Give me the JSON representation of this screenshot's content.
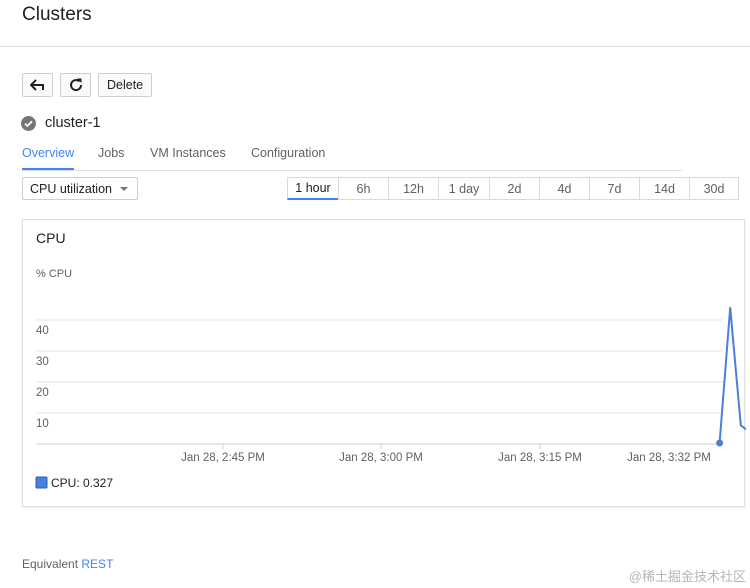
{
  "page": {
    "title": "Clusters"
  },
  "toolbar": {
    "back_icon": "back-arrow-icon",
    "refresh_icon": "refresh-icon",
    "delete_label": "Delete"
  },
  "cluster": {
    "status_icon": "check-circle-icon",
    "name": "cluster-1"
  },
  "tabs": [
    {
      "label": "Overview",
      "active": true
    },
    {
      "label": "Jobs",
      "active": false
    },
    {
      "label": "VM Instances",
      "active": false
    },
    {
      "label": "Configuration",
      "active": false
    }
  ],
  "metric_select": {
    "value": "CPU utilization"
  },
  "time_ranges": [
    {
      "label": "1 hour",
      "active": true
    },
    {
      "label": "6h",
      "active": false
    },
    {
      "label": "12h",
      "active": false
    },
    {
      "label": "1 day",
      "active": false
    },
    {
      "label": "2d",
      "active": false
    },
    {
      "label": "4d",
      "active": false
    },
    {
      "label": "7d",
      "active": false
    },
    {
      "label": "14d",
      "active": false
    },
    {
      "label": "30d",
      "active": false
    }
  ],
  "chart_data": {
    "type": "line",
    "title": "CPU",
    "ylabel": "% CPU",
    "xlabel": "",
    "ylim": [
      0,
      50
    ],
    "y_ticks": [
      10,
      20,
      30,
      40
    ],
    "x_ticks": [
      "Jan 28, 2:45 PM",
      "Jan 28, 3:00 PM",
      "Jan 28, 3:15 PM",
      "Jan 28, 3:32 PM"
    ],
    "grid": true,
    "color": "#4a7fdc",
    "series": [
      {
        "name": "CPU",
        "points": [
          {
            "x": "Jan 28, 3:32 PM",
            "y": 0.327
          },
          {
            "x": "Jan 28, 3:33 PM",
            "y": 44
          },
          {
            "x": "Jan 28, 3:34 PM",
            "y": 6
          },
          {
            "x": "Jan 28, 3:35 PM",
            "y": 3.5
          },
          {
            "x": "Jan 28, 3:36 PM",
            "y": 3.3
          },
          {
            "x": "Jan 28, 3:37 PM",
            "y": 2.7
          }
        ]
      }
    ],
    "legend": {
      "label": "CPU: 0.327",
      "placement": "bottom-left"
    }
  },
  "footer": {
    "prefix": "Equivalent",
    "link_label": "REST"
  },
  "watermark": "@稀土掘金技术社区"
}
